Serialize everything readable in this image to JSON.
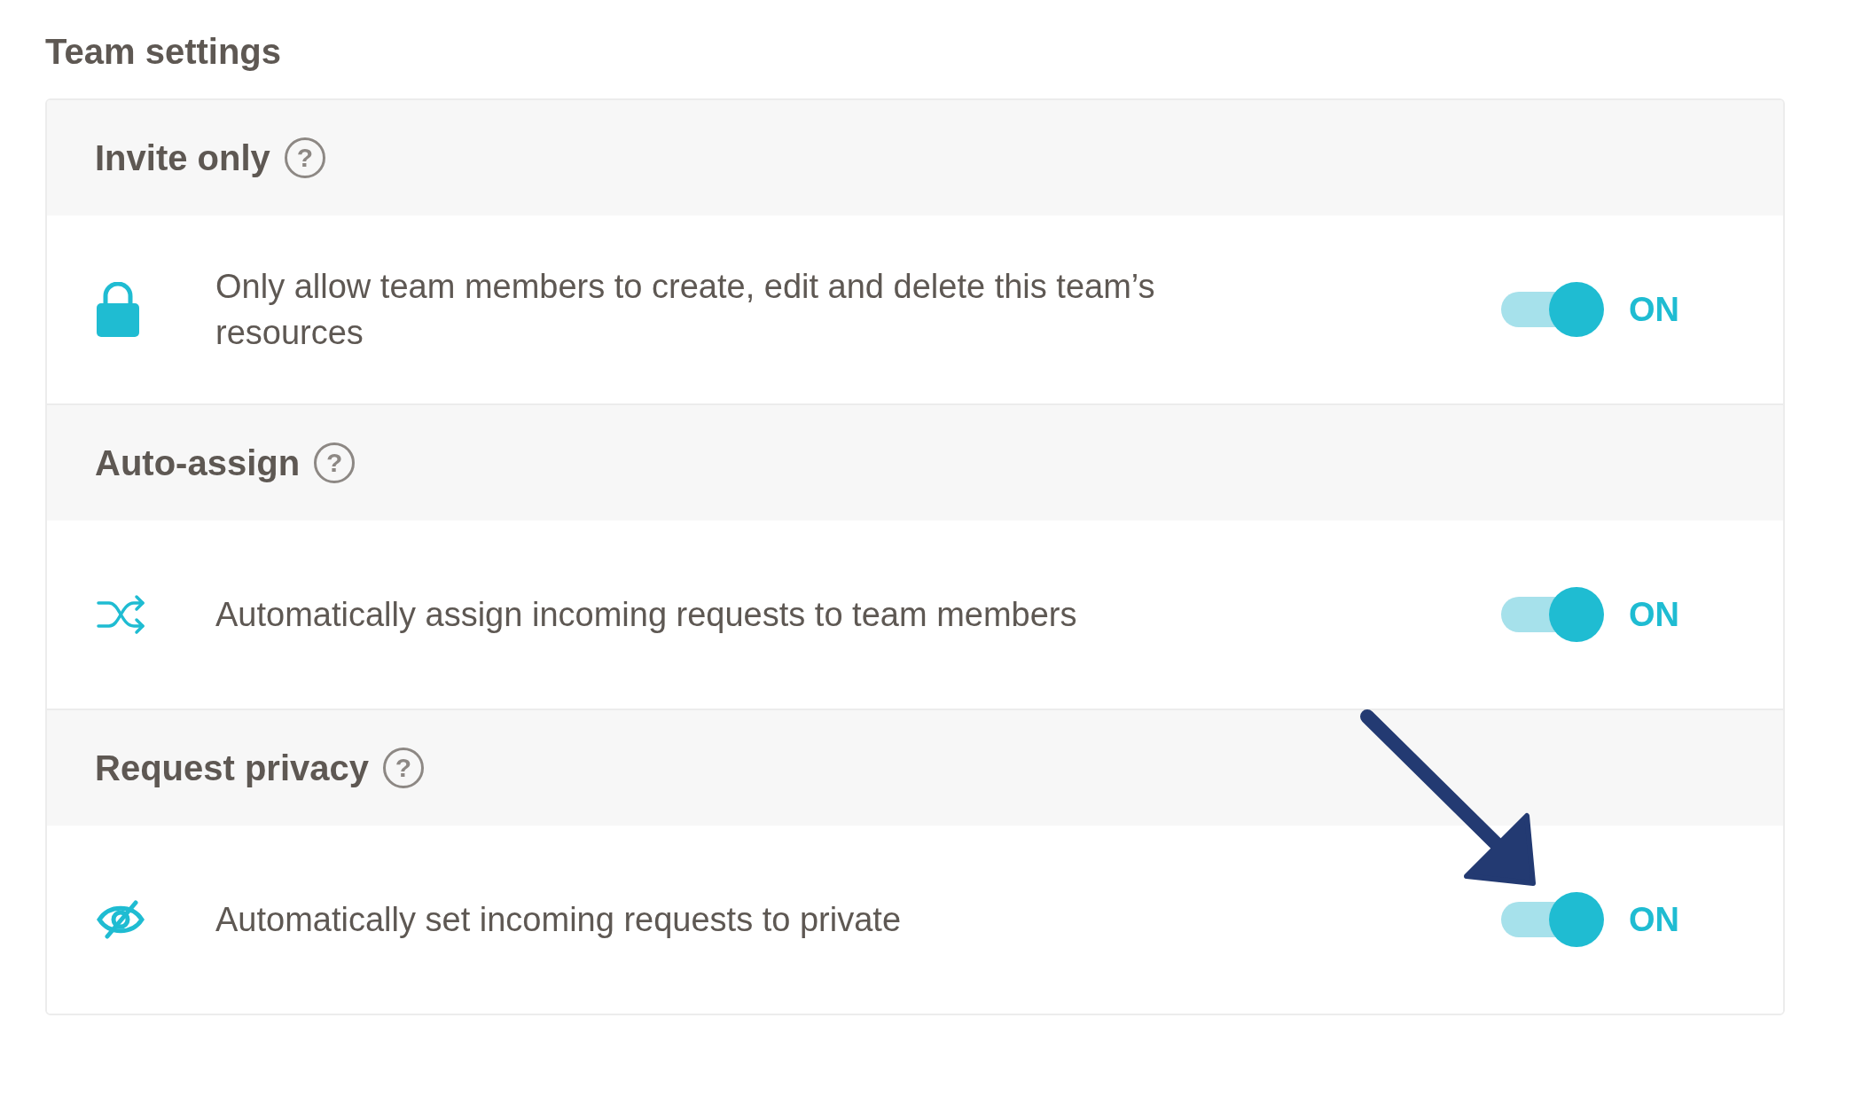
{
  "title": "Team settings",
  "sections": [
    {
      "heading": "Invite only",
      "help": "?",
      "setting": {
        "kind": "lock",
        "text": "Only allow team members to create, edit and delete this team’s resources",
        "on": true,
        "status": "ON"
      }
    },
    {
      "heading": "Auto-assign",
      "help": "?",
      "setting": {
        "kind": "shuffle",
        "text": "Automatically assign incoming requests to team members",
        "on": true,
        "status": "ON"
      }
    },
    {
      "heading": "Request privacy",
      "help": "?",
      "setting": {
        "kind": "eye-off",
        "text": "Automatically set incoming requests to private",
        "on": true,
        "status": "ON"
      }
    }
  ]
}
